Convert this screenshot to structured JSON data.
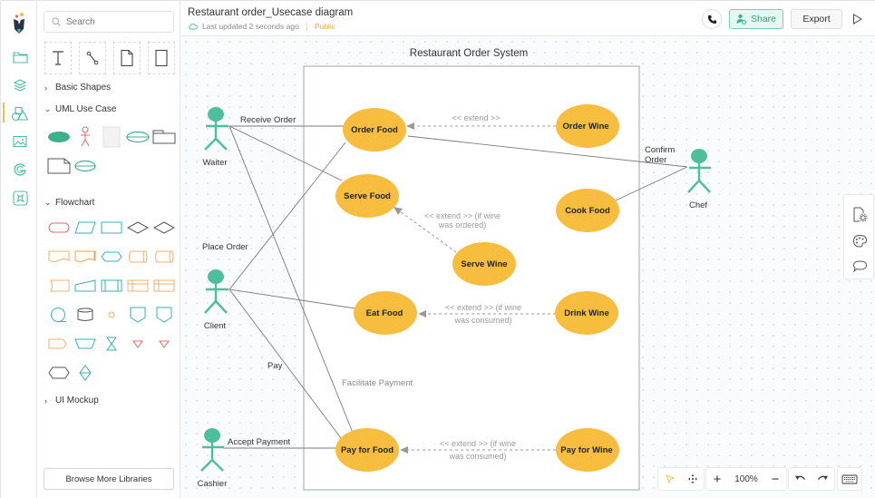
{
  "header": {
    "title": "Restaurant order_Usecase diagram",
    "last_updated": "Last updated 2 seconds ago",
    "visibility": "Public",
    "share_label": "Share",
    "export_label": "Export"
  },
  "library": {
    "search_placeholder": "Search",
    "sections": [
      {
        "label": "Basic Shapes",
        "expanded": false
      },
      {
        "label": "UML Use Case",
        "expanded": true
      },
      {
        "label": "Flowchart",
        "expanded": true
      },
      {
        "label": "UI Mockup",
        "expanded": false
      }
    ],
    "browse_label": "Browse More Libraries"
  },
  "rail": {
    "items": [
      "folder-icon",
      "layers-icon",
      "shapes-icon",
      "image-icon",
      "google-icon",
      "plugin-icon"
    ],
    "active": "shapes-icon"
  },
  "toolbar": {
    "zoom": "100%"
  },
  "diagram": {
    "system_title": "Restaurant Order System",
    "actors": [
      {
        "id": "waiter",
        "label": "Waiter"
      },
      {
        "id": "client",
        "label": "Client"
      },
      {
        "id": "cashier",
        "label": "Cashier"
      },
      {
        "id": "chef",
        "label": "Chef"
      }
    ],
    "use_cases": [
      {
        "id": "order_food",
        "label": "Order Food"
      },
      {
        "id": "order_wine",
        "label": "Order Wine"
      },
      {
        "id": "serve_food",
        "label": "Serve Food"
      },
      {
        "id": "cook_food",
        "label": "Cook Food"
      },
      {
        "id": "serve_wine",
        "label": "Serve Wine"
      },
      {
        "id": "eat_food",
        "label": "Eat Food"
      },
      {
        "id": "drink_wine",
        "label": "Drink Wine"
      },
      {
        "id": "pay_food",
        "label": "Pay for Food"
      },
      {
        "id": "pay_wine",
        "label": "Pay for Wine"
      }
    ],
    "association_labels": {
      "receive_order": "Receive Order",
      "confirm_order_1": "Confirm",
      "confirm_order_2": "Order",
      "place_order": "Place Order",
      "pay": "Pay",
      "facilitate_payment": "Facilitate Payment",
      "accept_payment": "Accept Payment"
    },
    "extend_labels": {
      "order_wine": "<< extend >>",
      "serve_wine_1": "<< extend >> (if wine",
      "serve_wine_2": "was ordered)",
      "drink_wine_1": "<< extend >> (if wine",
      "drink_wine_2": "was consumed)",
      "pay_wine_1": "<< extend >> (if wine",
      "pay_wine_2": "was consumed)"
    },
    "colors": {
      "use_case_fill": "#f7bd3f",
      "actor": "#4dbf9d",
      "line": "#7a7a7a",
      "extend_line": "#9a9a9a"
    }
  }
}
